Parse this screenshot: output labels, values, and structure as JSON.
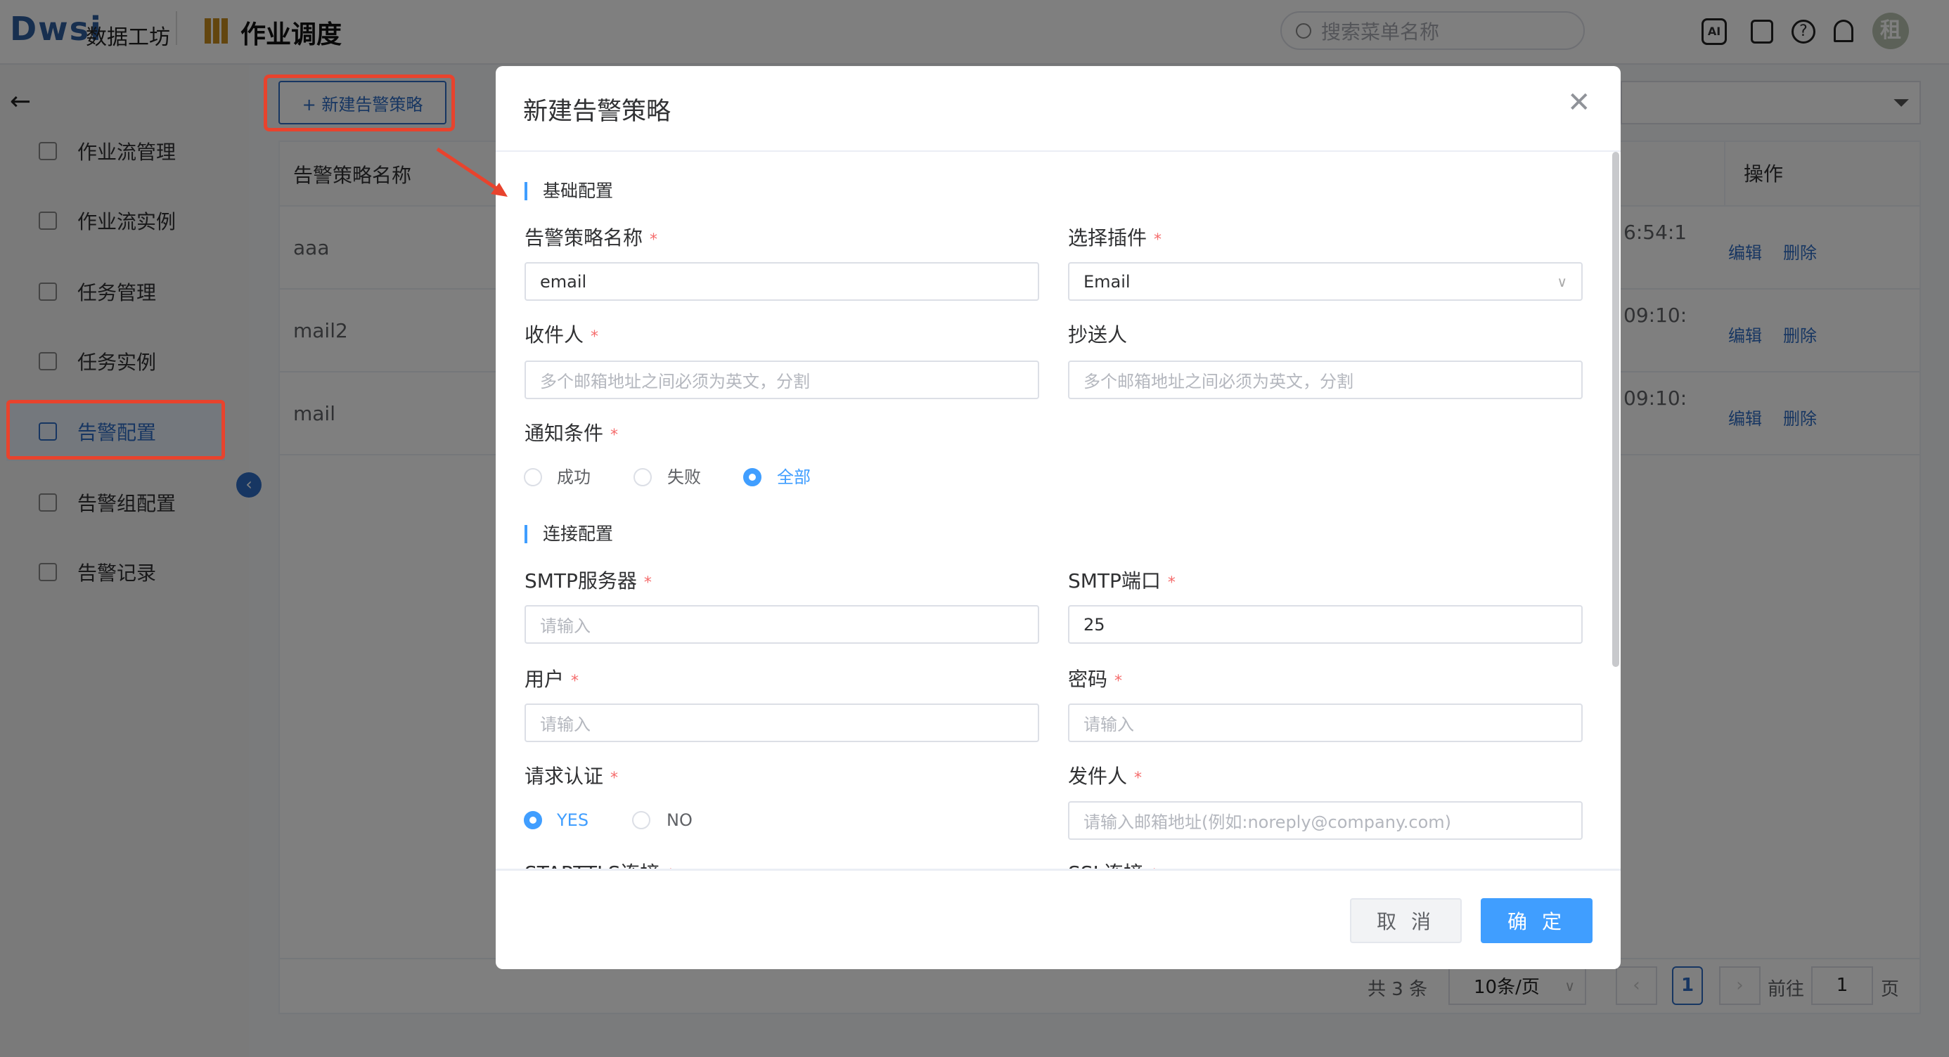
{
  "header": {
    "logo": "Dwsi",
    "brand": "数据工坊",
    "module_title": "作业调度",
    "search_placeholder": "搜索菜单名称",
    "avatar": "租",
    "icons": [
      "ai-icon",
      "plugin-icon",
      "help-icon",
      "bell-icon"
    ]
  },
  "sidebar": {
    "items": [
      {
        "label": "作业流管理"
      },
      {
        "label": "作业流实例"
      },
      {
        "label": "任务管理"
      },
      {
        "label": "任务实例"
      },
      {
        "label": "告警配置",
        "active": true
      },
      {
        "label": "告警组配置"
      },
      {
        "label": "告警记录"
      }
    ]
  },
  "main": {
    "new_button": "+ 新建告警策略",
    "columns": {
      "name": "告警策略名称",
      "actions": "操作"
    },
    "rows": [
      {
        "name": "aaa",
        "time": "6:54:1"
      },
      {
        "name": "mail2",
        "time": "09:10:"
      },
      {
        "name": "mail",
        "time": "09:10:"
      }
    ],
    "edit": "编辑",
    "delete": "删除",
    "pagination": {
      "total": "共 3 条",
      "page_size": "10条/页",
      "current": "1",
      "goto": "前往",
      "goto_value": "1",
      "page_unit": "页"
    }
  },
  "dialog": {
    "title": "新建告警策略",
    "sections": {
      "basic": "基础配置",
      "connection": "连接配置"
    },
    "fields": {
      "name": {
        "label": "告警策略名称",
        "value": "email"
      },
      "plugin": {
        "label": "选择插件",
        "value": "Email"
      },
      "to": {
        "label": "收件人",
        "placeholder": "多个邮箱地址之间必须为英文，分割"
      },
      "cc": {
        "label": "抄送人",
        "placeholder": "多个邮箱地址之间必须为英文，分割"
      },
      "condition": {
        "label": "通知条件",
        "options": [
          "成功",
          "失败",
          "全部"
        ],
        "selected": "全部"
      },
      "smtp_server": {
        "label": "SMTP服务器",
        "placeholder": "请输入"
      },
      "smtp_port": {
        "label": "SMTP端口",
        "value": "25"
      },
      "user": {
        "label": "用户",
        "placeholder": "请输入"
      },
      "password": {
        "label": "密码",
        "placeholder": "请输入"
      },
      "auth": {
        "label": "请求认证",
        "options": [
          "YES",
          "NO"
        ],
        "selected": "YES"
      },
      "sender": {
        "label": "发件人",
        "placeholder": "请输入邮箱地址(例如:noreply@company.com)"
      },
      "starttls": {
        "label": "STARTTLS连接"
      },
      "ssl": {
        "label": "SSL连接"
      }
    },
    "cancel": "取 消",
    "confirm": "确 定"
  },
  "colors": {
    "primary": "#409eff",
    "annotation": "#e8432d",
    "required": "#f56c6c"
  }
}
